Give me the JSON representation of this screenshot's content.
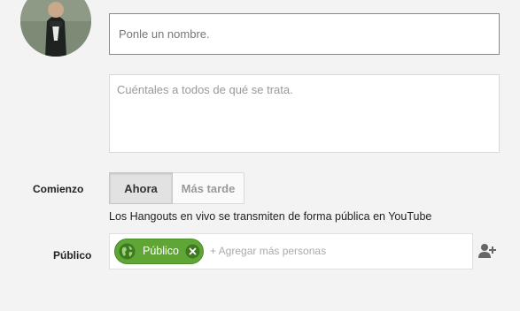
{
  "form": {
    "name_placeholder": "Ponle un nombre.",
    "description_placeholder": "Cuéntales a todos de qué se trata."
  },
  "start": {
    "label": "Comienzo",
    "now_label": "Ahora",
    "later_label": "Más tarde",
    "selected": "Ahora"
  },
  "notice": "Los Hangouts en vivo se transmiten de forma pública en YouTube",
  "audience": {
    "label": "Público",
    "chip_label": "Público",
    "add_placeholder": "+ Agregar más personas"
  },
  "icons": {
    "chip_globe": "globe-icon",
    "chip_remove": "close-icon",
    "add_person": "add-person-icon"
  },
  "colors": {
    "focus_border": "#4d90fe",
    "chip_green": "#5fa636"
  }
}
